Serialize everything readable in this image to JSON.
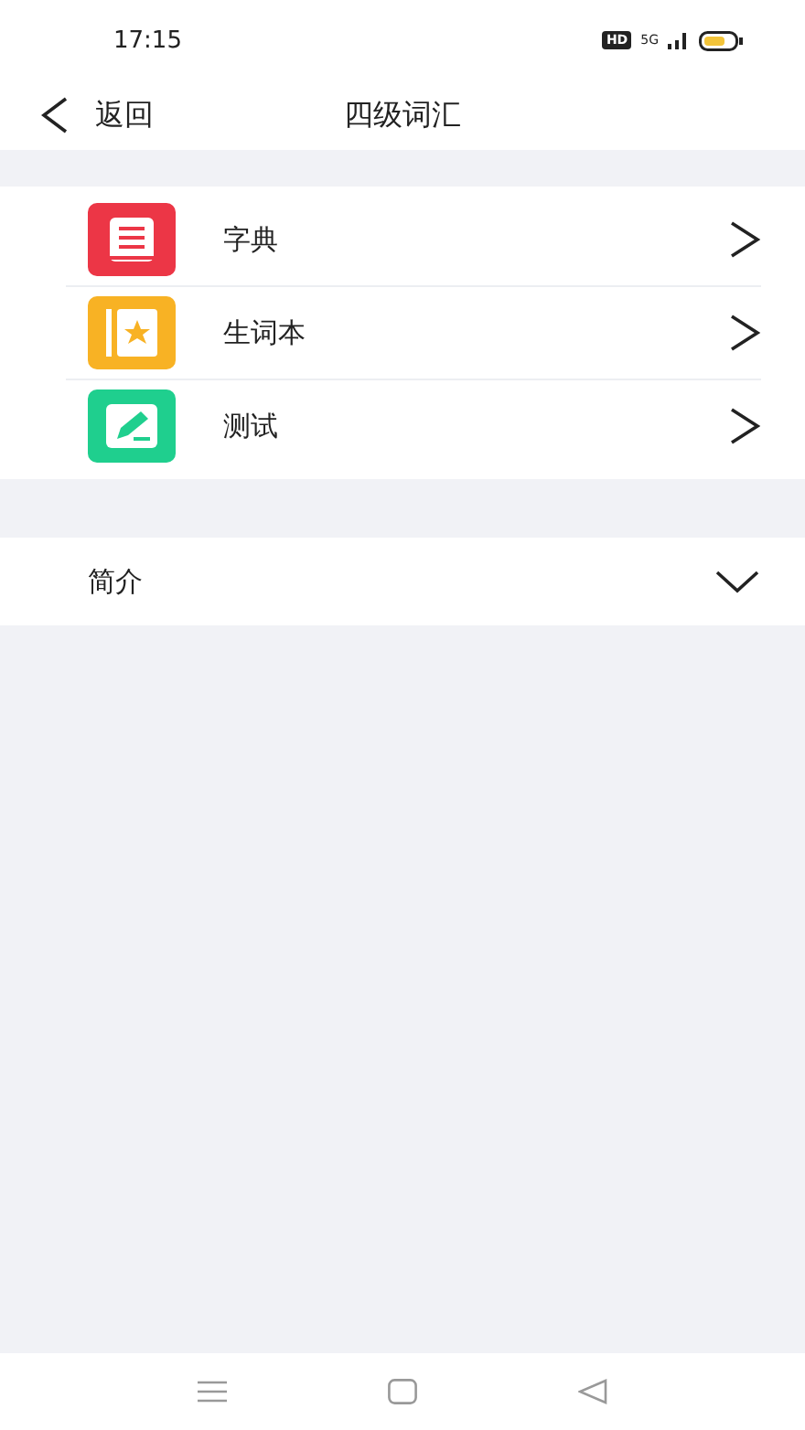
{
  "status_bar": {
    "time": "17:15",
    "hd": "HD",
    "network": "5G"
  },
  "header": {
    "back": "返回",
    "title": "四级词汇"
  },
  "menu": [
    {
      "label": "字典",
      "kind": "book",
      "color": "#ec3646"
    },
    {
      "label": "生词本",
      "kind": "star",
      "color": "#f8b224"
    },
    {
      "label": "测试",
      "kind": "pencil",
      "color": "#1fcf8e"
    }
  ],
  "intro": {
    "label": "简介",
    "expanded": false
  }
}
